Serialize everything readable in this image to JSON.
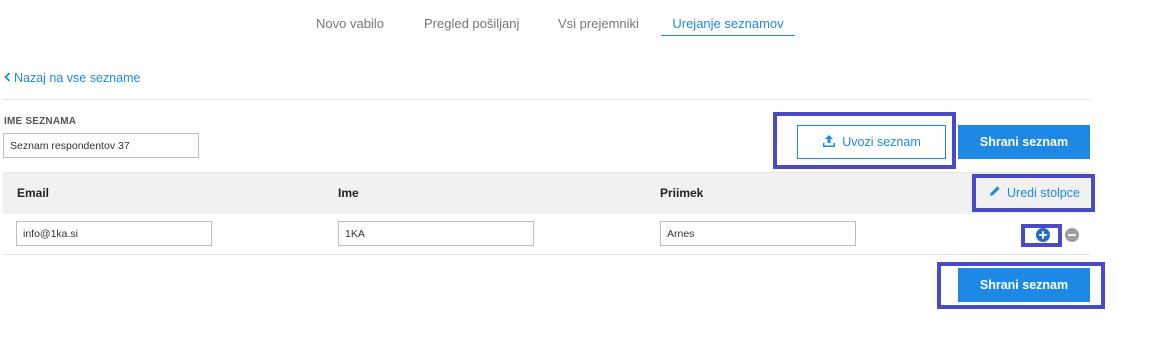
{
  "tabs": [
    {
      "label": "Novo vabilo"
    },
    {
      "label": "Pregled pošiljanj"
    },
    {
      "label": "Vsi prejemniki"
    },
    {
      "label": "Urejanje seznamov",
      "active": true
    }
  ],
  "back_link": {
    "label": "Nazaj na vse sezname"
  },
  "list_name": {
    "label": "IME SEZNAMA",
    "value": "Seznam respondentov 37"
  },
  "actions": {
    "import_label": "Uvozi seznam",
    "save_label": "Shrani seznam",
    "edit_columns_label": "Uredi stolpce"
  },
  "table": {
    "columns": [
      "Email",
      "Ime",
      "Priimek"
    ],
    "rows": [
      {
        "email": "info@1ka.si",
        "ime": "1KA",
        "priimek": "Arnes"
      }
    ]
  },
  "icons": {
    "back": "chevron-left-icon",
    "import": "upload-icon",
    "edit": "pencil-icon",
    "add_row": "plus-circle-icon",
    "remove_row": "minus-circle-icon"
  },
  "colors": {
    "accent": "#1e88e5",
    "highlight_border": "#4a4ac8",
    "add_icon": "#1e6fbf",
    "remove_icon": "#9e9e9e"
  }
}
